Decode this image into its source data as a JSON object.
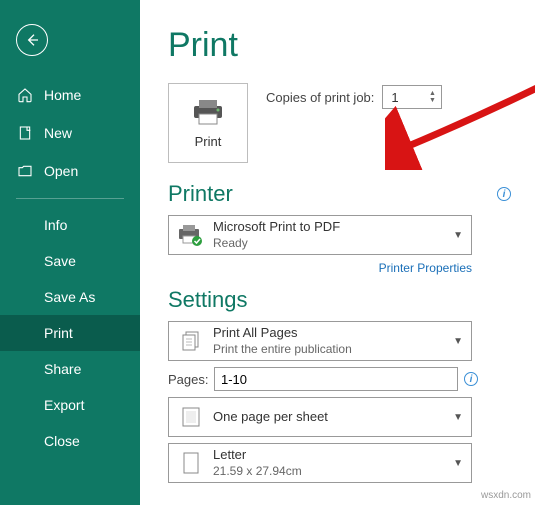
{
  "sidebar": {
    "top": [
      {
        "label": "Home",
        "key": "home"
      },
      {
        "label": "New",
        "key": "new"
      },
      {
        "label": "Open",
        "key": "open"
      }
    ],
    "sub": [
      {
        "label": "Info",
        "key": "info"
      },
      {
        "label": "Save",
        "key": "save"
      },
      {
        "label": "Save As",
        "key": "saveas"
      },
      {
        "label": "Print",
        "key": "print",
        "active": true
      },
      {
        "label": "Share",
        "key": "share"
      },
      {
        "label": "Export",
        "key": "export"
      },
      {
        "label": "Close",
        "key": "close"
      }
    ]
  },
  "page": {
    "title": "Print",
    "print_button_label": "Print",
    "copies_label": "Copies of print job:",
    "copies_value": "1"
  },
  "printer": {
    "section_title": "Printer",
    "name": "Microsoft Print to PDF",
    "status": "Ready",
    "properties_link": "Printer Properties"
  },
  "settings": {
    "section_title": "Settings",
    "print_all": {
      "title": "Print All Pages",
      "sub": "Print the entire publication"
    },
    "pages_label": "Pages:",
    "pages_value": "1-10",
    "layout": {
      "title": "One page per sheet"
    },
    "paper": {
      "title": "Letter",
      "sub": "21.59 x 27.94cm"
    }
  },
  "watermark": "wsxdn.com"
}
